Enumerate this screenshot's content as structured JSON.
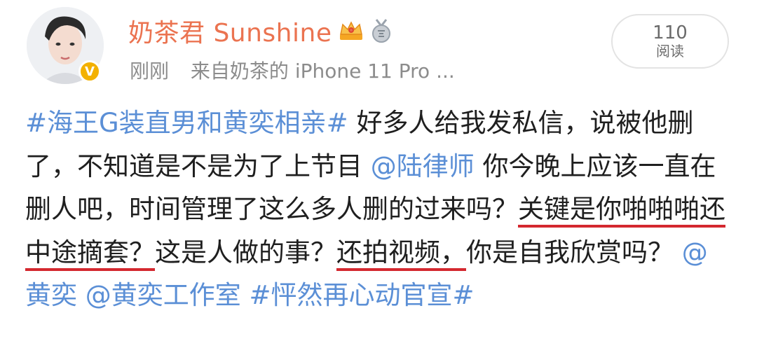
{
  "user": {
    "name": "奶茶君 Sunshine",
    "verified_mark": "V",
    "badge_icons": [
      "crown-icon",
      "medal-icon"
    ]
  },
  "meta": {
    "time": "刚刚",
    "source": "来自奶茶的 iPhone 11 Pro ..."
  },
  "read": {
    "count": "110",
    "label": "阅读"
  },
  "post": {
    "topic1": "#海王G装直男和黄奕相亲#",
    "t1": " 好多人给我发私信，说被他删了，不知道是不是为了上节目",
    "mention1": "@陆律师",
    "t2": " 你今晚上应该一直在删人吧，时间管理了这么多人删的过来吗？",
    "t3": "关键是你啪啪啪还中途摘套？",
    "t4": "这是人做的事？",
    "t5": "还拍视频，",
    "t6": "你是自我欣赏吗？",
    "mention2": "@黄奕",
    "mention3": "@黄奕工作室",
    "topic2": "#怦然再心动官宣#"
  },
  "colors": {
    "username": "#eb7350",
    "link": "#5b8fd6",
    "underline": "#d4282f",
    "meta": "#8c8c8c"
  }
}
